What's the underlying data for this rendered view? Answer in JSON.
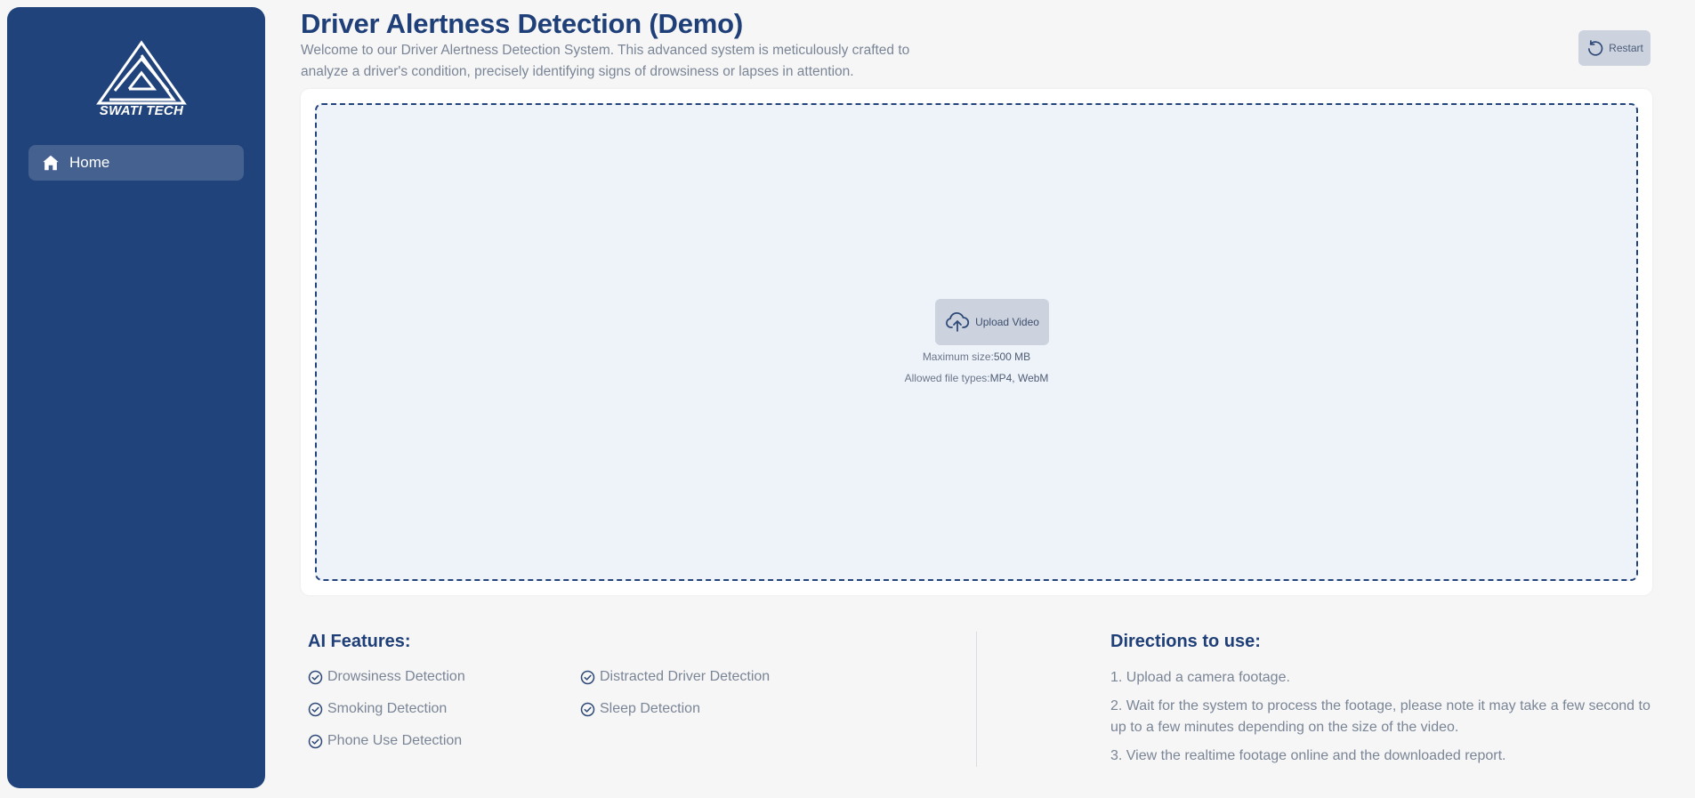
{
  "sidebar": {
    "logo_text": "SWATI TECH",
    "nav": [
      {
        "label": "Home",
        "icon": "home-icon"
      }
    ]
  },
  "header": {
    "title": "Driver Alertness Detection (Demo)",
    "description": "Welcome to our Driver Alertness Detection System. This advanced system is meticulously crafted to analyze a driver's condition, precisely identifying signs of drowsiness or lapses in attention.",
    "restart_label": "Restart"
  },
  "upload": {
    "button_label": "Upload Video",
    "max_size_label": "Maximum size:",
    "max_size_value": "500 MB",
    "types_label": "Allowed file types:",
    "types_value": "MP4, WebM"
  },
  "features": {
    "title": "AI Features:",
    "items": [
      "Drowsiness Detection",
      "Distracted Driver Detection",
      "Smoking Detection",
      "Sleep Detection",
      "Phone Use Detection"
    ]
  },
  "directions": {
    "title": "Directions to use:",
    "steps": [
      "1. Upload a camera footage.",
      "2. Wait for the system to process the footage, please note it may take a few second to up to a few minutes depending on the size of the video.",
      "3. View the realtime footage online and the downloaded report."
    ]
  },
  "colors": {
    "sidebar_bg": "#21437b",
    "accent": "#1f3f78",
    "page_bg": "#f6f6f6",
    "dropzone_bg": "#eef3fa",
    "button_bg": "#cdd3de"
  }
}
